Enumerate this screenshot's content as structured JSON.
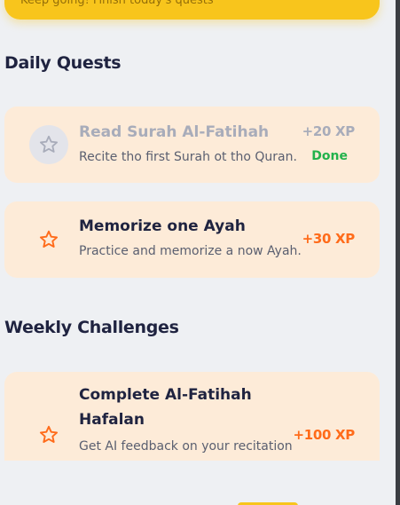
{
  "banner": {
    "text": "Keep going! Finish today's quests"
  },
  "daily": {
    "title": "Daily Quests",
    "quests": [
      {
        "title": "Read Surah Al-Fatihah",
        "description": "Recite tho first Surah ot tho Quran.",
        "xp": "+20 XP",
        "status": "Done",
        "icon": "star-outline-icon",
        "completed": true
      },
      {
        "title": "Memorize one Ayah",
        "description": "Practice and memorize a now Ayah.",
        "xp": "+30 XP",
        "icon": "star-outline-icon",
        "completed": false
      }
    ]
  },
  "weekly": {
    "title": "Weekly Challenges",
    "challenges": [
      {
        "title_line1": "Complete Al-Fatihah",
        "title_line2": "Hafalan",
        "description": "Get AI feedback on your recitation",
        "xp": "+100 XP",
        "icon": "star-outline-icon"
      }
    ]
  },
  "colors": {
    "background": "#eef0f3",
    "card": "#fdebd8",
    "accent_orange": "#ff6b1a",
    "done_green": "#22b24c",
    "muted": "#a8acba",
    "banner_yellow": "#f8c51c",
    "heading": "#1f2340"
  }
}
